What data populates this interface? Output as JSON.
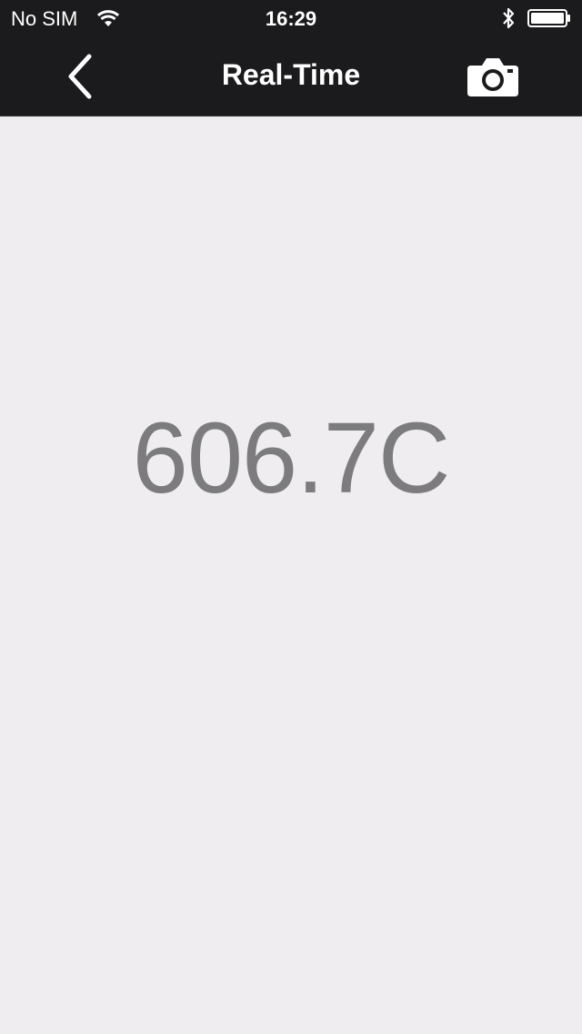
{
  "status_bar": {
    "carrier": "No SIM",
    "time": "16:29",
    "wifi_icon": "wifi-icon",
    "bluetooth_icon": "bluetooth-icon",
    "battery_icon": "battery-icon",
    "battery_level": 1.0
  },
  "nav": {
    "title": "Real-Time",
    "back_icon": "chevron-left-icon",
    "camera_icon": "camera-icon"
  },
  "reading": {
    "value": "606.7C"
  },
  "colors": {
    "nav_background": "#1b1a1c",
    "page_background": "#efedf0",
    "reading_text": "#7c7b7e"
  }
}
